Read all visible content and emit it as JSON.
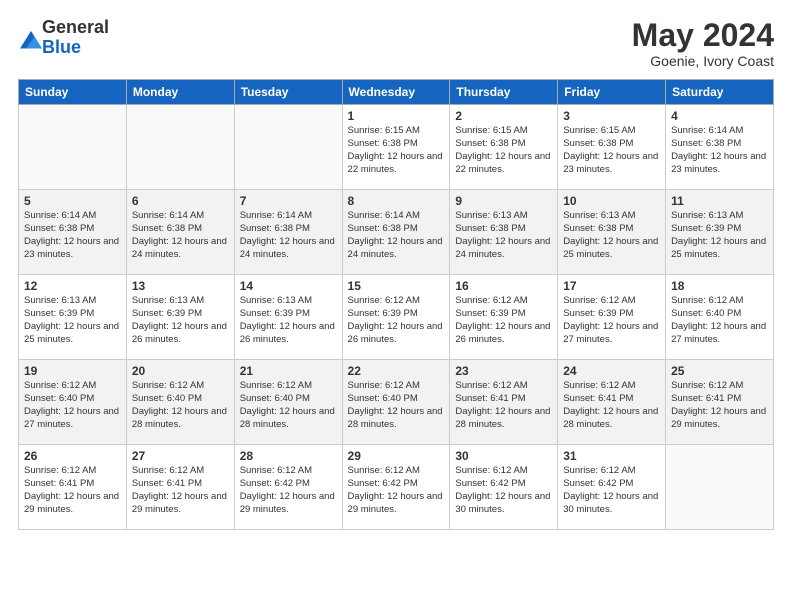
{
  "logo": {
    "general": "General",
    "blue": "Blue"
  },
  "header": {
    "month": "May 2024",
    "location": "Goenie, Ivory Coast"
  },
  "days_of_week": [
    "Sunday",
    "Monday",
    "Tuesday",
    "Wednesday",
    "Thursday",
    "Friday",
    "Saturday"
  ],
  "weeks": [
    [
      {
        "day": "",
        "info": ""
      },
      {
        "day": "",
        "info": ""
      },
      {
        "day": "",
        "info": ""
      },
      {
        "day": "1",
        "info": "Sunrise: 6:15 AM\nSunset: 6:38 PM\nDaylight: 12 hours and 22 minutes."
      },
      {
        "day": "2",
        "info": "Sunrise: 6:15 AM\nSunset: 6:38 PM\nDaylight: 12 hours and 22 minutes."
      },
      {
        "day": "3",
        "info": "Sunrise: 6:15 AM\nSunset: 6:38 PM\nDaylight: 12 hours and 23 minutes."
      },
      {
        "day": "4",
        "info": "Sunrise: 6:14 AM\nSunset: 6:38 PM\nDaylight: 12 hours and 23 minutes."
      }
    ],
    [
      {
        "day": "5",
        "info": "Sunrise: 6:14 AM\nSunset: 6:38 PM\nDaylight: 12 hours and 23 minutes."
      },
      {
        "day": "6",
        "info": "Sunrise: 6:14 AM\nSunset: 6:38 PM\nDaylight: 12 hours and 24 minutes."
      },
      {
        "day": "7",
        "info": "Sunrise: 6:14 AM\nSunset: 6:38 PM\nDaylight: 12 hours and 24 minutes."
      },
      {
        "day": "8",
        "info": "Sunrise: 6:14 AM\nSunset: 6:38 PM\nDaylight: 12 hours and 24 minutes."
      },
      {
        "day": "9",
        "info": "Sunrise: 6:13 AM\nSunset: 6:38 PM\nDaylight: 12 hours and 24 minutes."
      },
      {
        "day": "10",
        "info": "Sunrise: 6:13 AM\nSunset: 6:38 PM\nDaylight: 12 hours and 25 minutes."
      },
      {
        "day": "11",
        "info": "Sunrise: 6:13 AM\nSunset: 6:39 PM\nDaylight: 12 hours and 25 minutes."
      }
    ],
    [
      {
        "day": "12",
        "info": "Sunrise: 6:13 AM\nSunset: 6:39 PM\nDaylight: 12 hours and 25 minutes."
      },
      {
        "day": "13",
        "info": "Sunrise: 6:13 AM\nSunset: 6:39 PM\nDaylight: 12 hours and 26 minutes."
      },
      {
        "day": "14",
        "info": "Sunrise: 6:13 AM\nSunset: 6:39 PM\nDaylight: 12 hours and 26 minutes."
      },
      {
        "day": "15",
        "info": "Sunrise: 6:12 AM\nSunset: 6:39 PM\nDaylight: 12 hours and 26 minutes."
      },
      {
        "day": "16",
        "info": "Sunrise: 6:12 AM\nSunset: 6:39 PM\nDaylight: 12 hours and 26 minutes."
      },
      {
        "day": "17",
        "info": "Sunrise: 6:12 AM\nSunset: 6:39 PM\nDaylight: 12 hours and 27 minutes."
      },
      {
        "day": "18",
        "info": "Sunrise: 6:12 AM\nSunset: 6:40 PM\nDaylight: 12 hours and 27 minutes."
      }
    ],
    [
      {
        "day": "19",
        "info": "Sunrise: 6:12 AM\nSunset: 6:40 PM\nDaylight: 12 hours and 27 minutes."
      },
      {
        "day": "20",
        "info": "Sunrise: 6:12 AM\nSunset: 6:40 PM\nDaylight: 12 hours and 28 minutes."
      },
      {
        "day": "21",
        "info": "Sunrise: 6:12 AM\nSunset: 6:40 PM\nDaylight: 12 hours and 28 minutes."
      },
      {
        "day": "22",
        "info": "Sunrise: 6:12 AM\nSunset: 6:40 PM\nDaylight: 12 hours and 28 minutes."
      },
      {
        "day": "23",
        "info": "Sunrise: 6:12 AM\nSunset: 6:41 PM\nDaylight: 12 hours and 28 minutes."
      },
      {
        "day": "24",
        "info": "Sunrise: 6:12 AM\nSunset: 6:41 PM\nDaylight: 12 hours and 28 minutes."
      },
      {
        "day": "25",
        "info": "Sunrise: 6:12 AM\nSunset: 6:41 PM\nDaylight: 12 hours and 29 minutes."
      }
    ],
    [
      {
        "day": "26",
        "info": "Sunrise: 6:12 AM\nSunset: 6:41 PM\nDaylight: 12 hours and 29 minutes."
      },
      {
        "day": "27",
        "info": "Sunrise: 6:12 AM\nSunset: 6:41 PM\nDaylight: 12 hours and 29 minutes."
      },
      {
        "day": "28",
        "info": "Sunrise: 6:12 AM\nSunset: 6:42 PM\nDaylight: 12 hours and 29 minutes."
      },
      {
        "day": "29",
        "info": "Sunrise: 6:12 AM\nSunset: 6:42 PM\nDaylight: 12 hours and 29 minutes."
      },
      {
        "day": "30",
        "info": "Sunrise: 6:12 AM\nSunset: 6:42 PM\nDaylight: 12 hours and 30 minutes."
      },
      {
        "day": "31",
        "info": "Sunrise: 6:12 AM\nSunset: 6:42 PM\nDaylight: 12 hours and 30 minutes."
      },
      {
        "day": "",
        "info": ""
      }
    ]
  ]
}
